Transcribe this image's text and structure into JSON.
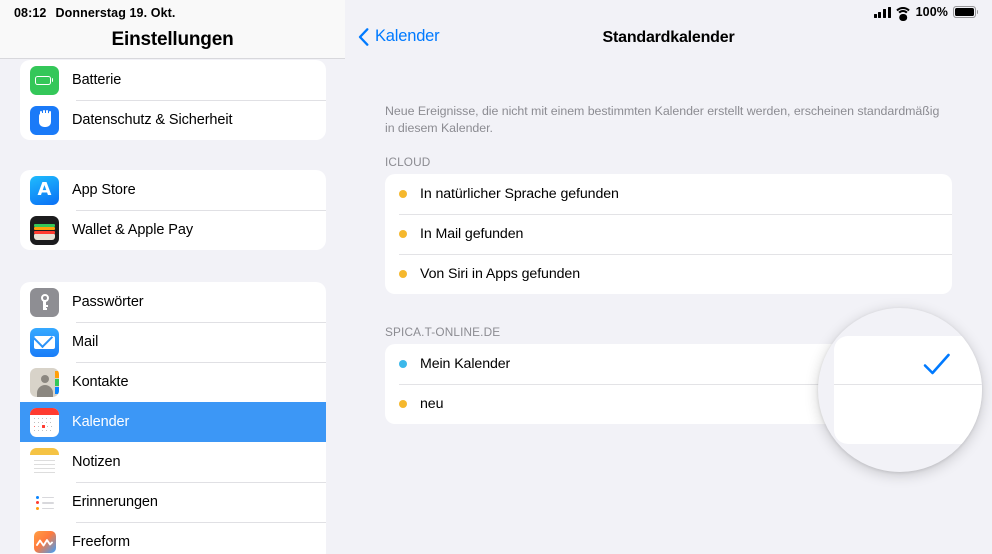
{
  "status_bar": {
    "time": "08:12",
    "date": "Donnerstag 19. Okt.",
    "battery_percent": "100%",
    "signal_icon": "cellular-signal-icon",
    "wifi_icon": "wifi-icon",
    "battery_icon": "battery-icon"
  },
  "sidebar": {
    "title": "Einstellungen",
    "groups": [
      {
        "items": [
          {
            "label": "Batterie",
            "icon": "battery-app-icon",
            "selected": false
          },
          {
            "label": "Datenschutz & Sicherheit",
            "icon": "privacy-hand-icon",
            "selected": false
          }
        ]
      },
      {
        "items": [
          {
            "label": "App Store",
            "icon": "app-store-icon",
            "selected": false
          },
          {
            "label": "Wallet & Apple Pay",
            "icon": "wallet-icon",
            "selected": false
          }
        ]
      },
      {
        "items": [
          {
            "label": "Passwörter",
            "icon": "key-icon",
            "selected": false
          },
          {
            "label": "Mail",
            "icon": "mail-envelope-icon",
            "selected": false
          },
          {
            "label": "Kontakte",
            "icon": "contacts-icon",
            "selected": false
          },
          {
            "label": "Kalender",
            "icon": "calendar-icon",
            "selected": true
          },
          {
            "label": "Notizen",
            "icon": "notes-icon",
            "selected": false
          },
          {
            "label": "Erinnerungen",
            "icon": "reminders-icon",
            "selected": false
          },
          {
            "label": "Freeform",
            "icon": "freeform-icon",
            "selected": false
          }
        ]
      }
    ]
  },
  "detail": {
    "back_label": "Kalender",
    "back_icon": "chevron-left-icon",
    "title": "Standardkalender",
    "footnote": "Neue Ereignisse, die nicht mit einem bestimmten Kalender erstellt werden, erscheinen standardmäßig in diesem Kalender.",
    "sections": [
      {
        "header": "ICLOUD",
        "rows": [
          {
            "label": "In natürlicher Sprache gefunden",
            "bullet_color": "#f5b82e",
            "checked": false
          },
          {
            "label": "In Mail gefunden",
            "bullet_color": "#f5b82e",
            "checked": false
          },
          {
            "label": "Von Siri in Apps gefunden",
            "bullet_color": "#f5b82e",
            "checked": false
          }
        ]
      },
      {
        "header": "SPICA.T-ONLINE.DE",
        "rows": [
          {
            "label": "Mein Kalender",
            "bullet_color": "#3cb8ea",
            "checked": true
          },
          {
            "label": "neu",
            "bullet_color": "#f5b82e",
            "checked": false
          }
        ]
      }
    ]
  },
  "loupe": {
    "magnified_icon": "checkmark-icon",
    "checkmark_color": "#007aff"
  },
  "colors": {
    "accent_blue": "#007aff",
    "selection_blue": "#3c97f6",
    "background": "#f2f2f7",
    "card": "#ffffff",
    "secondary_text": "#8c8c92"
  }
}
